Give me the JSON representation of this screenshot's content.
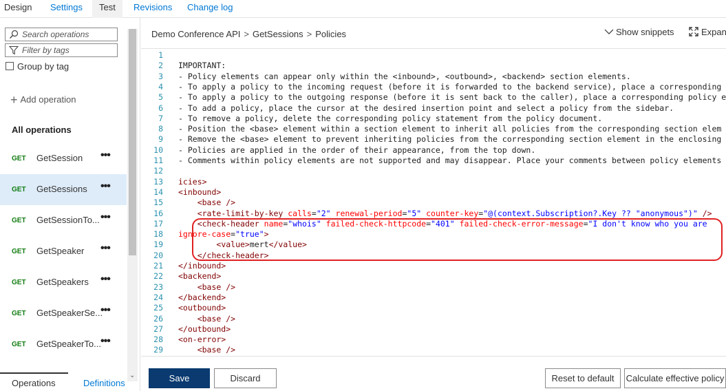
{
  "top_tabs": {
    "design": "Design",
    "settings": "Settings",
    "test": "Test",
    "revisions": "Revisions",
    "changelog": "Change log"
  },
  "sidebar": {
    "search_placeholder": "Search operations",
    "filter_placeholder": "Filter by tags",
    "group_by_tag": "Group by tag",
    "add_operation": "Add operation",
    "all_operations": "All operations",
    "operations": [
      {
        "method": "GET",
        "name": "GetSession",
        "selected": false
      },
      {
        "method": "GET",
        "name": "GetSessions",
        "selected": true
      },
      {
        "method": "GET",
        "name": "GetSessionTo...",
        "selected": false
      },
      {
        "method": "GET",
        "name": "GetSpeaker",
        "selected": false
      },
      {
        "method": "GET",
        "name": "GetSpeakers",
        "selected": false
      },
      {
        "method": "GET",
        "name": "GetSpeakerSe...",
        "selected": false
      },
      {
        "method": "GET",
        "name": "GetSpeakerTo...",
        "selected": false
      }
    ],
    "more": "•••",
    "bottom_tabs": {
      "operations": "Operations",
      "definitions": "Definitions"
    }
  },
  "breadcrumb": {
    "api": "Demo Conference API",
    "op": "GetSessions",
    "page": "Policies",
    "sep": ">"
  },
  "toolbar": {
    "show_snippets": "Show snippets",
    "expand": "Expand"
  },
  "editor": {
    "lines": [
      {
        "n": "1",
        "tokens": []
      },
      {
        "n": "2",
        "tokens": [
          {
            "t": "cmt",
            "s": "IMPORTANT:"
          }
        ]
      },
      {
        "n": "3",
        "tokens": [
          {
            "t": "cmt",
            "s": "- Policy elements can appear only within the <inbound>, <outbound>, <backend> section elements."
          }
        ]
      },
      {
        "n": "4",
        "tokens": [
          {
            "t": "cmt",
            "s": "- To apply a policy to the incoming request (before it is forwarded to the backend service), place a corresponding"
          }
        ]
      },
      {
        "n": "5",
        "tokens": [
          {
            "t": "cmt",
            "s": "- To apply a policy to the outgoing response (before it is sent back to the caller), place a corresponding policy e"
          }
        ]
      },
      {
        "n": "6",
        "tokens": [
          {
            "t": "cmt",
            "s": "- To add a policy, place the cursor at the desired insertion point and select a policy from the sidebar."
          }
        ]
      },
      {
        "n": "7",
        "tokens": [
          {
            "t": "cmt",
            "s": "- To remove a policy, delete the corresponding policy statement from the policy document."
          }
        ]
      },
      {
        "n": "8",
        "tokens": [
          {
            "t": "cmt",
            "s": "- Position the <base> element within a section element to inherit all policies from the corresponding section elem"
          }
        ]
      },
      {
        "n": "9",
        "tokens": [
          {
            "t": "cmt",
            "s": "- Remove the <base> element to prevent inheriting policies from the corresponding section element in the enclosing"
          }
        ]
      },
      {
        "n": "10",
        "tokens": [
          {
            "t": "cmt",
            "s": "- Policies are applied in the order of their appearance, from the top down."
          }
        ]
      },
      {
        "n": "11",
        "tokens": [
          {
            "t": "cmt",
            "s": "- Comments within policy elements are not supported and may disappear. Place your comments between policy elements"
          }
        ]
      },
      {
        "n": "12",
        "tokens": []
      },
      {
        "n": "13",
        "tokens": [
          {
            "t": "tag",
            "s": "icies>"
          }
        ]
      },
      {
        "n": "14",
        "tokens": [
          {
            "t": "tag",
            "s": "<inbound>"
          }
        ]
      },
      {
        "n": "15",
        "tokens": [
          {
            "t": "txt",
            "s": "    "
          },
          {
            "t": "tag",
            "s": "<base />"
          }
        ]
      },
      {
        "n": "16",
        "tokens": [
          {
            "t": "txt",
            "s": "    "
          },
          {
            "t": "tag",
            "s": "<rate-limit-by-key"
          },
          {
            "t": "attr",
            "s": " calls"
          },
          {
            "t": "txt",
            "s": "="
          },
          {
            "t": "val",
            "s": "\"2\""
          },
          {
            "t": "attr",
            "s": " renewal-period"
          },
          {
            "t": "txt",
            "s": "="
          },
          {
            "t": "val",
            "s": "\"5\""
          },
          {
            "t": "attr",
            "s": " counter-key"
          },
          {
            "t": "txt",
            "s": "="
          },
          {
            "t": "val",
            "s": "\"@(context.Subscription?.Key ?? \"anonymous\")\""
          },
          {
            "t": "tag",
            "s": " />"
          }
        ]
      },
      {
        "n": "17",
        "tokens": [
          {
            "t": "txt",
            "s": "    "
          },
          {
            "t": "tag",
            "s": "<check-header"
          },
          {
            "t": "attr",
            "s": " name"
          },
          {
            "t": "txt",
            "s": "="
          },
          {
            "t": "val",
            "s": "\"whois\""
          },
          {
            "t": "attr",
            "s": " failed-check-httpcode"
          },
          {
            "t": "txt",
            "s": "="
          },
          {
            "t": "val",
            "s": "\"401\""
          },
          {
            "t": "attr",
            "s": " failed-check-error-message"
          },
          {
            "t": "txt",
            "s": "="
          },
          {
            "t": "val",
            "s": "\"I don't know who you are"
          }
        ]
      },
      {
        "n": "18",
        "tokens": [
          {
            "t": "attr",
            "s": "ignore-case"
          },
          {
            "t": "txt",
            "s": "="
          },
          {
            "t": "val",
            "s": "\"true\""
          },
          {
            "t": "tag",
            "s": ">"
          }
        ]
      },
      {
        "n": "19",
        "tokens": [
          {
            "t": "txt",
            "s": "        "
          },
          {
            "t": "tag",
            "s": "<value>"
          },
          {
            "t": "txt",
            "s": "mert"
          },
          {
            "t": "tag",
            "s": "</value>"
          }
        ]
      },
      {
        "n": "20",
        "tokens": [
          {
            "t": "txt",
            "s": "    "
          },
          {
            "t": "tag",
            "s": "</check-header>"
          }
        ]
      },
      {
        "n": "21",
        "tokens": [
          {
            "t": "tag",
            "s": "</inbound>"
          }
        ]
      },
      {
        "n": "22",
        "tokens": [
          {
            "t": "tag",
            "s": "<backend>"
          }
        ]
      },
      {
        "n": "23",
        "tokens": [
          {
            "t": "txt",
            "s": "    "
          },
          {
            "t": "tag",
            "s": "<base />"
          }
        ]
      },
      {
        "n": "24",
        "tokens": [
          {
            "t": "tag",
            "s": "</backend>"
          }
        ]
      },
      {
        "n": "25",
        "tokens": [
          {
            "t": "tag",
            "s": "<outbound>"
          }
        ]
      },
      {
        "n": "26",
        "tokens": [
          {
            "t": "txt",
            "s": "    "
          },
          {
            "t": "tag",
            "s": "<base />"
          }
        ]
      },
      {
        "n": "27",
        "tokens": [
          {
            "t": "tag",
            "s": "</outbound>"
          }
        ]
      },
      {
        "n": "28",
        "tokens": [
          {
            "t": "tag",
            "s": "<on-error>"
          }
        ]
      },
      {
        "n": "29",
        "tokens": [
          {
            "t": "txt",
            "s": "    "
          },
          {
            "t": "tag",
            "s": "<base />"
          }
        ]
      }
    ]
  },
  "actions": {
    "save": "Save",
    "discard": "Discard",
    "reset": "Reset to default",
    "calculate": "Calculate effective policy"
  },
  "colors": {
    "accent": "#0078d4",
    "save_button": "#0a3a70",
    "get_method": "#107c10",
    "highlight_outline": "#e02020",
    "selected_row": "#deecf9"
  }
}
